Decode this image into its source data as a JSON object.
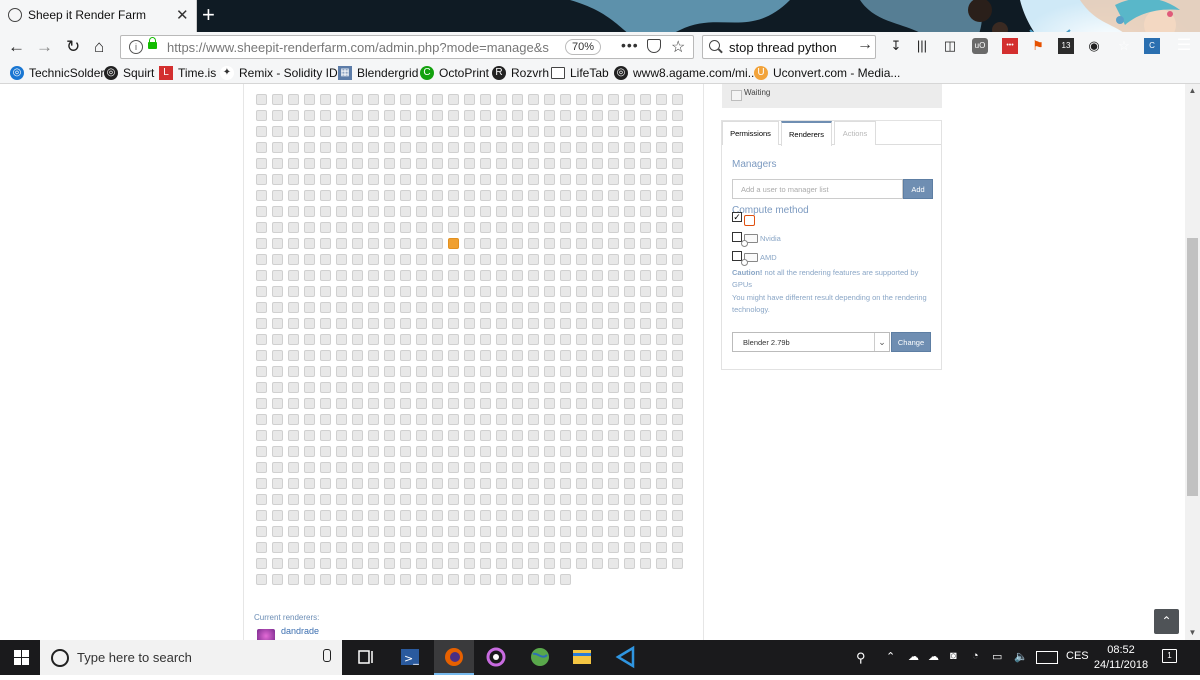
{
  "browser": {
    "tab_title": "Sheep it Render Farm",
    "tab_close": "✕",
    "new_tab": "+",
    "url": "https://www.sheepit-renderfarm.com/admin.php?mode=manage&s",
    "zoom": "70%",
    "url_more": "•••",
    "search_value": "stop thread python",
    "search_go": "→"
  },
  "bookmarks": [
    {
      "label": "TechnicSolder",
      "icon": "globe-icon",
      "color": "#1976d2"
    },
    {
      "label": "Squirt",
      "icon": "globe-icon",
      "color": "#222222"
    },
    {
      "label": "Time.is",
      "icon": "time-icon",
      "color": "#d32f2f"
    },
    {
      "label": "Remix - Solidity IDE",
      "icon": "remix-icon",
      "color": "#333333"
    },
    {
      "label": "Blendergrid",
      "icon": "grid-icon",
      "color": "#5c7ca8"
    },
    {
      "label": "OctoPrint",
      "icon": "octoprint-icon",
      "color": "#13a10e"
    },
    {
      "label": "Rozvrh",
      "icon": "rozvrh-icon",
      "color": "#222222"
    },
    {
      "label": "LifeTab",
      "icon": "folder-icon",
      "color": "#444444"
    },
    {
      "label": "www8.agame.com/mi...",
      "icon": "globe-icon",
      "color": "#222222"
    },
    {
      "label": "Uconvert.com - Media...",
      "icon": "uconvert-icon",
      "color": "#f2a33a"
    }
  ],
  "page": {
    "grid": {
      "total_cells": 830,
      "columns": 27,
      "active_cell_index": 255,
      "active_color": "#f0a030"
    },
    "current_renderers_label": "Current renderers:",
    "renderer_name": "dandrade",
    "waiting_label": "Waiting",
    "tabs": [
      "Permissions",
      "Renderers",
      "Actions"
    ],
    "managers_heading": "Managers",
    "manager_placeholder": "Add a user to manager list",
    "add_button": "Add",
    "compute_heading": "Compute method",
    "compute_options": [
      {
        "label": "",
        "checked": true,
        "icon": "cpu-icon"
      },
      {
        "label": "Nvidia",
        "checked": false,
        "icon": "gpu-icon"
      },
      {
        "label": "AMD",
        "checked": false,
        "icon": "gpu-icon"
      }
    ],
    "caution_bold": "Caution!",
    "caution_text": " not all the rendering features are supported by GPUs",
    "caution_text2": "You might have different result depending on the rendering technology.",
    "renderer_select": "Blender 2.79b",
    "change_button": "Change",
    "scroll_top_icon": "chevron-up-icon"
  },
  "taskbar": {
    "search_placeholder": "Type here to search",
    "language": "CES",
    "time": "08:52",
    "date": "24/11/2018",
    "notification_count": "1"
  }
}
